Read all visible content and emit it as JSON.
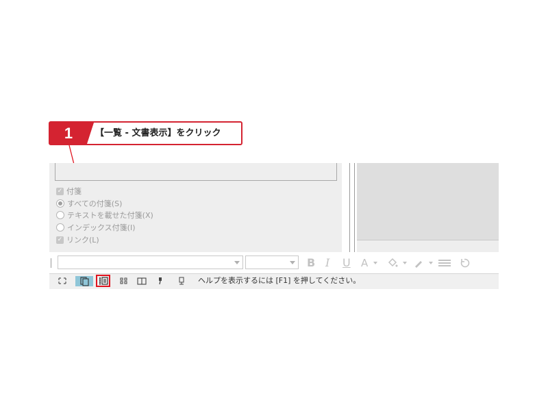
{
  "callout": {
    "step_number": "1",
    "text": "【一覧 - 文書表示】をクリック",
    "accent_color": "#d42331"
  },
  "options_panel": {
    "items": [
      {
        "type": "checkbox",
        "checked": true,
        "label": "付箋"
      },
      {
        "type": "radio",
        "checked": true,
        "label": "すべての付箋(S)"
      },
      {
        "type": "radio",
        "checked": false,
        "label": "テキストを載せた付箋(X)"
      },
      {
        "type": "radio",
        "checked": false,
        "label": "インデックス付箋(I)"
      },
      {
        "type": "checkbox",
        "checked": true,
        "label": "リンク(L)"
      }
    ]
  },
  "format_toolbar": {
    "font_name_value": "",
    "font_size_value": "",
    "bold_label": "B",
    "italic_label": "I",
    "underline_label": "U",
    "font_color_label": "A",
    "icons": [
      "fill-color-icon",
      "pen-icon",
      "align-icon",
      "undo-icon"
    ]
  },
  "status_bar": {
    "icons": [
      "fullscreen-icon",
      "pages-icon",
      "list-document-icon",
      "thumbnails-icon",
      "two-pane-icon",
      "tag-icon",
      "bookmark-icon"
    ],
    "active_icon": "pages-icon",
    "highlighted_icon": "list-document-icon",
    "message": "ヘルプを表示するには [F1] を押してください。"
  }
}
